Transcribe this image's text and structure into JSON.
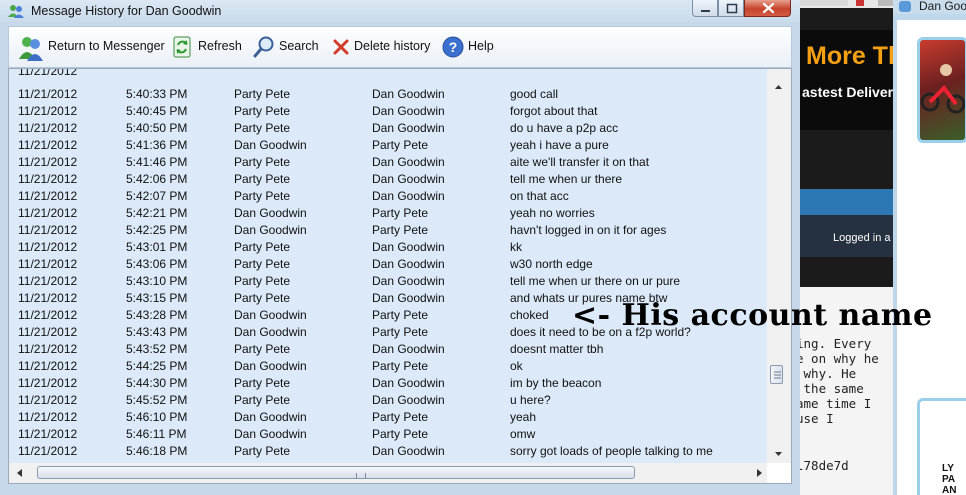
{
  "window": {
    "title": "Message History for Dan Goodwin"
  },
  "toolbar": {
    "return_label": "Return to Messenger",
    "refresh_label": "Refresh",
    "search_label": "Search",
    "delete_label": "Delete history",
    "help_label": "Help"
  },
  "messages": [
    {
      "date": "11/21/2012",
      "time": "5:40:33 PM",
      "from": "Party Pete",
      "to": "Dan Goodwin",
      "msg": "good call"
    },
    {
      "date": "11/21/2012",
      "time": "5:40:45 PM",
      "from": "Party Pete",
      "to": "Dan Goodwin",
      "msg": "forgot about that"
    },
    {
      "date": "11/21/2012",
      "time": "5:40:50 PM",
      "from": "Party Pete",
      "to": "Dan Goodwin",
      "msg": "do u have a p2p acc"
    },
    {
      "date": "11/21/2012",
      "time": "5:41:36 PM",
      "from": "Dan Goodwin",
      "to": "Party Pete",
      "msg": "yeah i have a pure"
    },
    {
      "date": "11/21/2012",
      "time": "5:41:46 PM",
      "from": "Party Pete",
      "to": "Dan Goodwin",
      "msg": "aite we'll transfer it on that"
    },
    {
      "date": "11/21/2012",
      "time": "5:42:06 PM",
      "from": "Party Pete",
      "to": "Dan Goodwin",
      "msg": "tell me when ur there"
    },
    {
      "date": "11/21/2012",
      "time": "5:42:07 PM",
      "from": "Party Pete",
      "to": "Dan Goodwin",
      "msg": "on that acc"
    },
    {
      "date": "11/21/2012",
      "time": "5:42:21 PM",
      "from": "Dan Goodwin",
      "to": "Party Pete",
      "msg": "yeah no worries"
    },
    {
      "date": "11/21/2012",
      "time": "5:42:25 PM",
      "from": "Dan Goodwin",
      "to": "Party Pete",
      "msg": "havn't logged in on it for ages"
    },
    {
      "date": "11/21/2012",
      "time": "5:43:01 PM",
      "from": "Party Pete",
      "to": "Dan Goodwin",
      "msg": "kk"
    },
    {
      "date": "11/21/2012",
      "time": "5:43:06 PM",
      "from": "Party Pete",
      "to": "Dan Goodwin",
      "msg": "w30 north edge"
    },
    {
      "date": "11/21/2012",
      "time": "5:43:10 PM",
      "from": "Party Pete",
      "to": "Dan Goodwin",
      "msg": "tell me when ur there on ur pure"
    },
    {
      "date": "11/21/2012",
      "time": "5:43:15 PM",
      "from": "Party Pete",
      "to": "Dan Goodwin",
      "msg": "and whats ur pures name btw"
    },
    {
      "date": "11/21/2012",
      "time": "5:43:28 PM",
      "from": "Dan Goodwin",
      "to": "Party Pete",
      "msg": "choked"
    },
    {
      "date": "11/21/2012",
      "time": "5:43:43 PM",
      "from": "Dan Goodwin",
      "to": "Party Pete",
      "msg": "does it need to be on a f2p world?"
    },
    {
      "date": "11/21/2012",
      "time": "5:43:52 PM",
      "from": "Party Pete",
      "to": "Dan Goodwin",
      "msg": "doesnt matter tbh"
    },
    {
      "date": "11/21/2012",
      "time": "5:44:25 PM",
      "from": "Dan Goodwin",
      "to": "Party Pete",
      "msg": "ok"
    },
    {
      "date": "11/21/2012",
      "time": "5:44:30 PM",
      "from": "Party Pete",
      "to": "Dan Goodwin",
      "msg": "im by the beacon"
    },
    {
      "date": "11/21/2012",
      "time": "5:45:52 PM",
      "from": "Party Pete",
      "to": "Dan Goodwin",
      "msg": "u here?"
    },
    {
      "date": "11/21/2012",
      "time": "5:46:10 PM",
      "from": "Dan Goodwin",
      "to": "Party Pete",
      "msg": "yeah"
    },
    {
      "date": "11/21/2012",
      "time": "5:46:11 PM",
      "from": "Dan Goodwin",
      "to": "Party Pete",
      "msg": "omw"
    },
    {
      "date": "11/21/2012",
      "time": "5:46:18 PM",
      "from": "Party Pete",
      "to": "Dan Goodwin",
      "msg": "sorry got loads of people talking to me"
    }
  ],
  "annotation": {
    "text": "<- His account name"
  },
  "background_browser": {
    "banner_title": "More Th",
    "banner_sub": "astest Delivery",
    "logged_in": "Logged in a",
    "paper_text": "ing. Every\ne on why he\n why. He\n the same\name time I\nuse I",
    "hash": "l78de7d"
  },
  "background_chat": {
    "title": "Dan Goo",
    "logo_text": "LY\nPA\nAN"
  },
  "colors": {
    "row_background": "#dbe9f8",
    "window_frame": "#c6d8ea",
    "close_button": "#c7442c",
    "annotation_text": "#000000"
  }
}
